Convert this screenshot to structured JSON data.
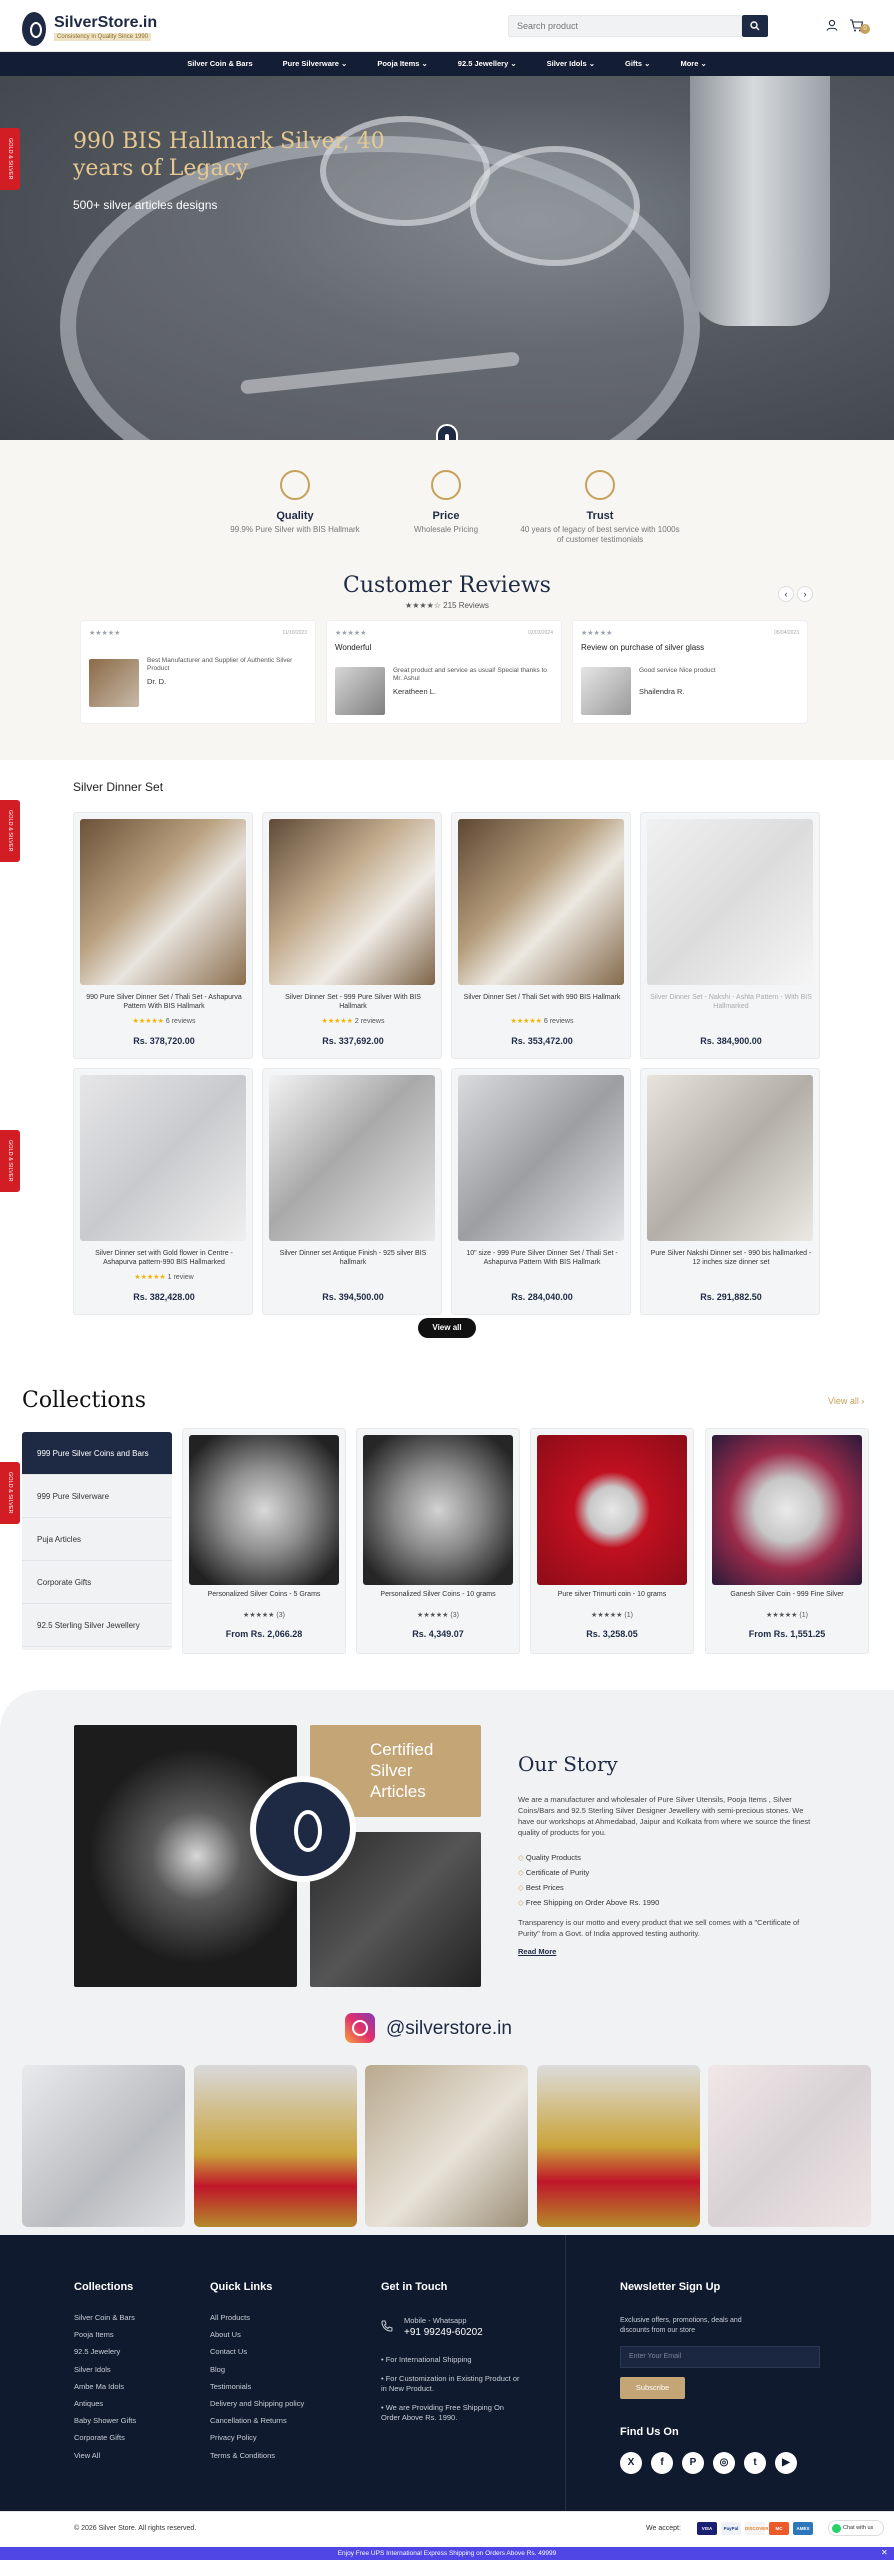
{
  "header": {
    "brand": "SilverStore.in",
    "tagline": "Consistency in Quality Since 1990",
    "search_placeholder": "Search product",
    "cart_count": "0"
  },
  "nav": [
    "Silver Coin & Bars",
    "Pure Silverware ⌄",
    "Pooja Items ⌄",
    "92.5 Jewellery ⌄",
    "Silver Idols ⌄",
    "Gifts ⌄",
    "More ⌄"
  ],
  "side_tab": "GOLD & SILVER",
  "hero": {
    "title": "990 BIS Hallmark Silver, 40 years of Legacy",
    "subtitle": "500+ silver articles designs"
  },
  "features": [
    {
      "icon": "quality-badge-icon",
      "title": "Quality",
      "desc": "99.9% Pure Silver with BIS Hallmark"
    },
    {
      "icon": "price-tag-icon",
      "title": "Price",
      "desc": "Wholesale Pricing"
    },
    {
      "icon": "trust-award-icon",
      "title": "Trust",
      "desc": "40 years of legacy of best service with 1000s of customer testimonials"
    }
  ],
  "reviews": {
    "title": "Customer Reviews",
    "summary": "★★★★☆ 215 Reviews",
    "items": [
      {
        "stars": "★★★★★",
        "date": "11/10/2023",
        "title": "",
        "text": "Best Manufacturer and Supplier of Authentic Silver Product",
        "name": "Dr. D."
      },
      {
        "stars": "★★★★★",
        "date": "02/03/2024",
        "title": "Wonderful",
        "text": "Great product and service as usual! Special thanks to Mr. Ashul",
        "name": "Keratheen L."
      },
      {
        "stars": "★★★★★",
        "date": "05/04/2023",
        "title": "Review on purchase of silver glass",
        "text": "Good service Nice product",
        "name": "Shailendra R."
      }
    ]
  },
  "products": {
    "section_title": "Silver Dinner Set",
    "view_all": "View all",
    "items": [
      {
        "name": "990 Pure Silver Dinner Set / Thali Set - Ashapurva Pattern With BIS Hallmark",
        "rating": "★★★★★ 6 reviews",
        "price": "Rs. 378,720.00",
        "sold_out": false
      },
      {
        "name": "Silver Dinner Set - 999 Pure Silver With BIS Hallmark",
        "rating": "★★★★★ 2 reviews",
        "price": "Rs. 337,692.00",
        "sold_out": false
      },
      {
        "name": "Silver Dinner Set / Thali Set with 990 BIS Hallmark",
        "rating": "★★★★★ 6 reviews",
        "price": "Rs. 353,472.00",
        "sold_out": false
      },
      {
        "name": "Silver Dinner Set - Nakshi - Ashta Pattern - With BIS Hallmarked",
        "rating": "",
        "price": "Rs. 384,900.00",
        "sold_out": true
      },
      {
        "name": "Silver Dinner set with Gold flower in Centre - Ashapurva pattern-990 BIS Hallmarked",
        "rating": "★★★★★ 1 review",
        "price": "Rs. 382,428.00",
        "sold_out": false
      },
      {
        "name": "Silver Dinner set Antique Finish - 925 silver BIS hallmark",
        "rating": "",
        "price": "Rs. 394,500.00",
        "sold_out": false
      },
      {
        "name": "10\" size - 999 Pure Silver Dinner Set / Thali Set - Ashapurva Pattern With BIS Hallmark",
        "rating": "",
        "price": "Rs. 284,040.00",
        "sold_out": false
      },
      {
        "name": "Pure Silver Nakshi Dinner set - 990 bis hallmarked - 12 inches size dinner set",
        "rating": "",
        "price": "Rs. 291,882.50",
        "sold_out": false
      }
    ]
  },
  "collections": {
    "title": "Collections",
    "view_all": "View all ›",
    "menu": [
      "999 Pure Silver Coins and Bars",
      "999 Pure Silverware",
      "Puja Articles",
      "Corporate Gifts",
      "92.5 Sterling Silver Jewellery"
    ],
    "items": [
      {
        "name": "Personalized Silver Coins - 5 Grams",
        "rating": "★★★★★ (3)",
        "price": "From Rs. 2,066.28"
      },
      {
        "name": "Personalized Silver Coins - 10 grams",
        "rating": "★★★★★ (3)",
        "price": "Rs. 4,349.07"
      },
      {
        "name": "Pure silver Trimurti coin - 10 grams",
        "rating": "★★★★★ (1)",
        "price": "Rs. 3,258.05"
      },
      {
        "name": "Ganesh Silver Coin - 999 Fine Silver",
        "rating": "★★★★★ (1)",
        "price": "From Rs. 1,551.25"
      }
    ]
  },
  "story": {
    "badge": "Certified Silver Articles",
    "title": "Our Story",
    "p1": "We are a manufacturer and wholesaler of Pure Silver Utensils, Pooja Items , Silver Coins/Bars and 92.5 Sterling Silver Designer Jewellery with semi-precious stones. We have our workshops at Ahmedabad, Jaipur and Kolkata from where we source the finest quality of products for you.",
    "list": [
      "Quality Products",
      "Certificate of Purity",
      "Best Prices",
      "Free Shipping on Order Above Rs. 1990"
    ],
    "p2": "Transparency is our motto and every product that we sell comes with a \"Certificate of Purity\" from a Govt. of India approved testing authority.",
    "read_more": "Read More"
  },
  "instagram": {
    "handle": "@silverstore.in"
  },
  "footer": {
    "collections_title": "Collections",
    "collections": [
      "Silver Coin & Bars",
      "Pooja Items",
      "92.5 Jewelery",
      "Silver Idols",
      "Ambe Ma Idols",
      "Antiques",
      "Baby Shower Gifts",
      "Corporate Gifts",
      "View All"
    ],
    "quick_title": "Quick Links",
    "quick": [
      "All Products",
      "About Us",
      "Contact Us",
      "Blog",
      "Testimonials",
      "Delivery and Shipping policy",
      "Cancellation & Returns",
      "Privacy Policy",
      "Terms & Conditions"
    ],
    "contact_title": "Get in Touch",
    "phone_label": "Mobile - Whatsapp",
    "phone": "+91 99249-60202",
    "contact_notes": [
      "For International Shipping",
      "For Customization in Existing Product or in New Product.",
      "We are Providing Free Shipping On Order Above Rs. 1990."
    ],
    "newsletter_title": "Newsletter Sign Up",
    "newsletter_text": "Exclusive offers, promotions, deals and discounts from our store",
    "newsletter_placeholder": "Enter Your Email",
    "subscribe": "Subscribe",
    "find_us": "Find Us On",
    "social": [
      "X",
      "f",
      "P",
      "◎",
      "t",
      "▶"
    ],
    "copyright": "© 2026 Silver Store. All rights reserved.",
    "we_accept": "We accept:",
    "payments": [
      "VISA",
      "PayPal",
      "DISCOVER",
      "MC",
      "AMEX"
    ],
    "chat": "Chat with us"
  },
  "promo": "Enjoy Free UPS International Express Shipping on Orders Above Rs. 49999",
  "colors": {
    "navy": "#1e2a44",
    "gold": "#c6a15b",
    "red": "#d21d25",
    "promo": "#4f46e5"
  }
}
